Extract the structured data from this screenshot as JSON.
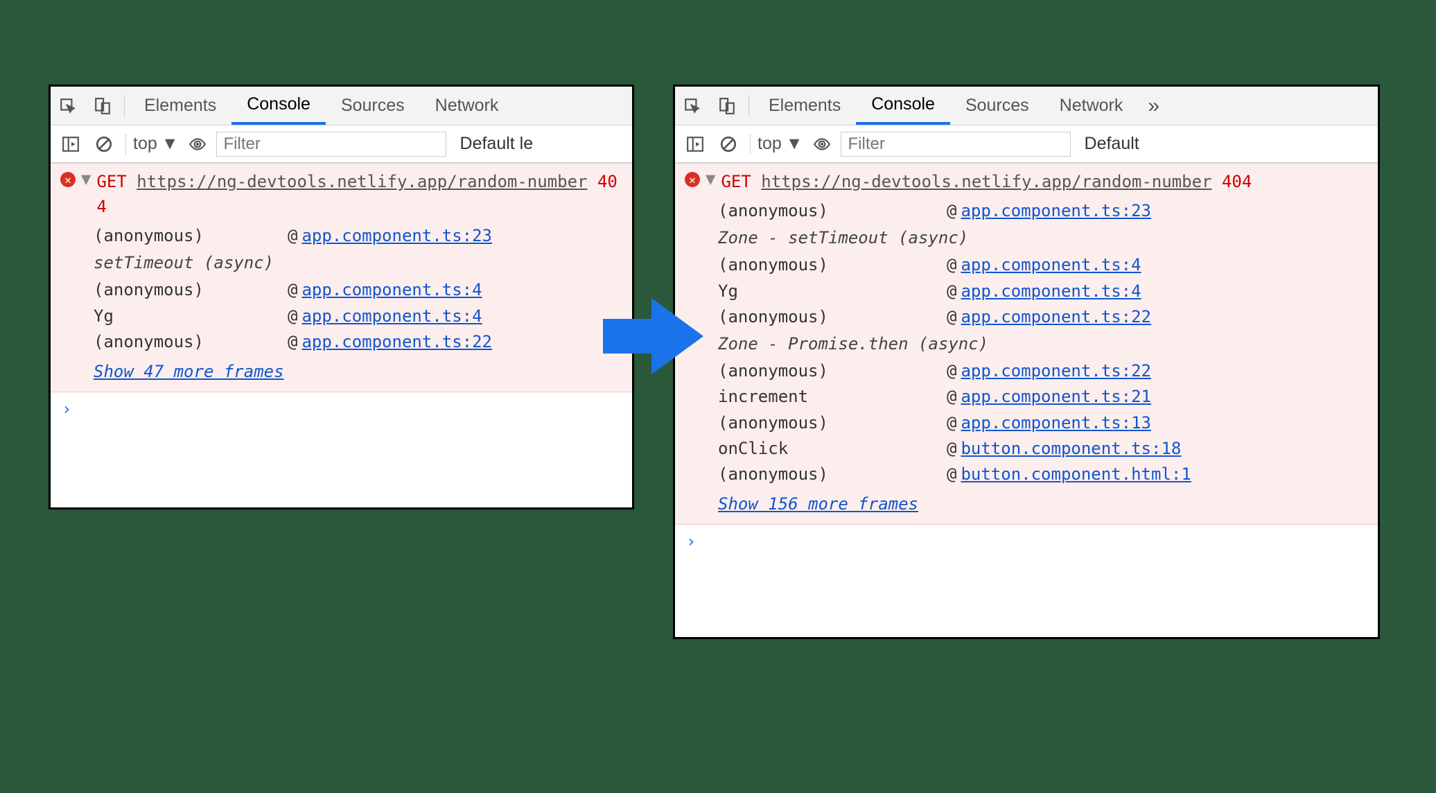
{
  "shared": {
    "tabs": {
      "elements": "Elements",
      "console": "Console",
      "sources": "Sources",
      "network": "Network",
      "more": "»"
    },
    "toolbar": {
      "context": "top",
      "filter_placeholder": "Filter",
      "levels_left": "Default le",
      "levels_right": "Default"
    }
  },
  "left": {
    "error": {
      "method": "GET",
      "url": "https://ng-devtools.netlify.app/random-number",
      "status": "404"
    },
    "stack": [
      {
        "type": "row",
        "fn": "(anonymous)",
        "src": "app.component.ts:23"
      },
      {
        "type": "group",
        "label": "setTimeout (async)"
      },
      {
        "type": "row",
        "fn": "(anonymous)",
        "src": "app.component.ts:4"
      },
      {
        "type": "row",
        "fn": "Yg",
        "src": "app.component.ts:4"
      },
      {
        "type": "row",
        "fn": "(anonymous)",
        "src": "app.component.ts:22"
      }
    ],
    "show_more": "Show 47 more frames"
  },
  "right": {
    "error": {
      "method": "GET",
      "url": "https://ng-devtools.netlify.app/random-number",
      "status": "404"
    },
    "stack": [
      {
        "type": "row",
        "fn": "(anonymous)",
        "src": "app.component.ts:23"
      },
      {
        "type": "group",
        "label": "Zone - setTimeout (async)"
      },
      {
        "type": "row",
        "fn": "(anonymous)",
        "src": "app.component.ts:4"
      },
      {
        "type": "row",
        "fn": "Yg",
        "src": "app.component.ts:4"
      },
      {
        "type": "row",
        "fn": "(anonymous)",
        "src": "app.component.ts:22"
      },
      {
        "type": "group",
        "label": "Zone - Promise.then (async)"
      },
      {
        "type": "row",
        "fn": "(anonymous)",
        "src": "app.component.ts:22"
      },
      {
        "type": "row",
        "fn": "increment",
        "src": "app.component.ts:21"
      },
      {
        "type": "row",
        "fn": "(anonymous)",
        "src": "app.component.ts:13"
      },
      {
        "type": "row",
        "fn": "onClick",
        "src": "button.component.ts:18"
      },
      {
        "type": "row",
        "fn": "(anonymous)",
        "src": "button.component.html:1"
      }
    ],
    "show_more": "Show 156 more frames"
  },
  "prompt": "›"
}
